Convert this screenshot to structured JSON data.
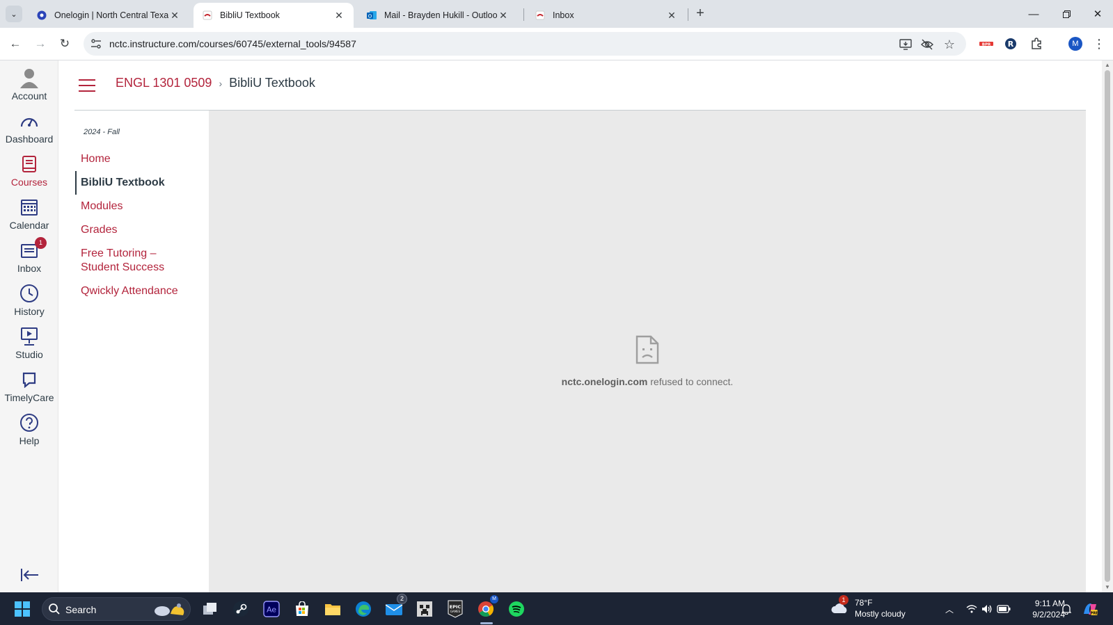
{
  "browser": {
    "tabs": [
      {
        "label": "Onelogin | North Central Texas",
        "active": false
      },
      {
        "label": "BibliU Textbook",
        "active": true
      },
      {
        "label": "Mail - Brayden Hukill - Outlook",
        "active": false
      },
      {
        "label": "Inbox",
        "active": false
      }
    ],
    "url": "nctc.instructure.com/courses/60745/external_tools/94587",
    "profile_initial": "M"
  },
  "global_nav": {
    "items": [
      {
        "label": "Account",
        "icon": "account-icon"
      },
      {
        "label": "Dashboard",
        "icon": "dashboard-icon"
      },
      {
        "label": "Courses",
        "icon": "courses-icon"
      },
      {
        "label": "Calendar",
        "icon": "calendar-icon"
      },
      {
        "label": "Inbox",
        "icon": "inbox-icon",
        "badge": "1"
      },
      {
        "label": "History",
        "icon": "history-icon"
      },
      {
        "label": "Studio",
        "icon": "studio-icon"
      },
      {
        "label": "TimelyCare",
        "icon": "timelycare-icon"
      },
      {
        "label": "Help",
        "icon": "help-icon"
      }
    ]
  },
  "breadcrumb": {
    "course": "ENGL 1301 0509",
    "current": "BibliU Textbook"
  },
  "course_nav": {
    "term": "2024 - Fall",
    "items": [
      {
        "label": "Home"
      },
      {
        "label": "BibliU Textbook",
        "active": true
      },
      {
        "label": "Modules"
      },
      {
        "label": "Grades"
      },
      {
        "label": "Free Tutoring – Student Success"
      },
      {
        "label": "Qwickly Attendance"
      }
    ]
  },
  "frame_error": {
    "host": "nctc.onelogin.com",
    "message": " refused to connect."
  },
  "taskbar": {
    "search_label": "Search",
    "mail_badge": "2",
    "weather_temp": "78°F",
    "weather_cond": "Mostly cloudy",
    "weather_badge": "1",
    "time": "9:11 AM",
    "date": "9/2/2024"
  },
  "colors": {
    "accent": "#b3243c",
    "text": "#2d3b45",
    "nav_icon": "#2d3b83"
  }
}
